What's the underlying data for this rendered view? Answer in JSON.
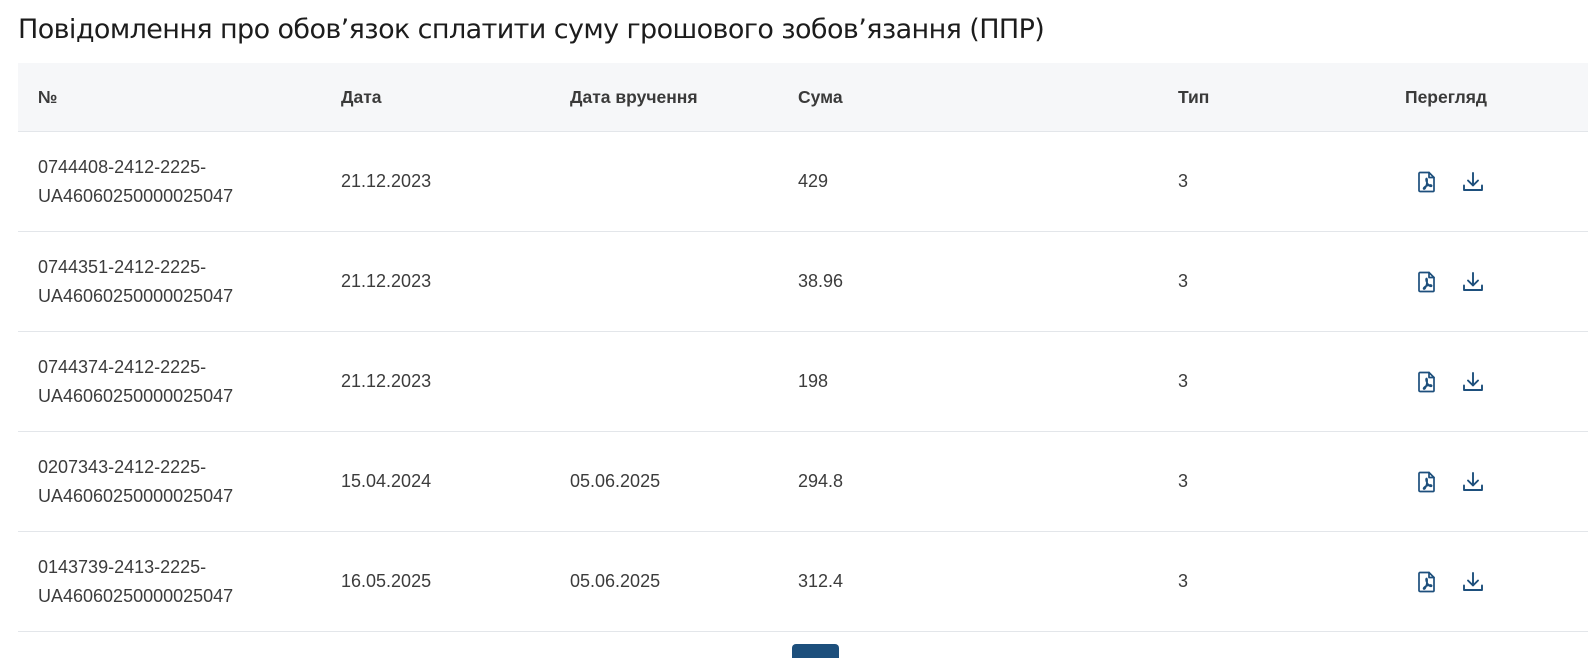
{
  "title": "Повідомлення про обов’язок сплатити суму грошового зобов’язання (ППР)",
  "columns": {
    "number": "№",
    "date": "Дата",
    "delivery_date": "Дата вручення",
    "sum": "Сума",
    "type": "Тип",
    "view": "Перегляд"
  },
  "rows": [
    {
      "number_line1": "0744408-2412-2225-",
      "number_line2": "UA46060250000025047",
      "date": "21.12.2023",
      "delivery_date": "",
      "sum": "429",
      "type": "3"
    },
    {
      "number_line1": "0744351-2412-2225-",
      "number_line2": "UA46060250000025047",
      "date": "21.12.2023",
      "delivery_date": "",
      "sum": "38.96",
      "type": "3"
    },
    {
      "number_line1": "0744374-2412-2225-",
      "number_line2": "UA46060250000025047",
      "date": "21.12.2023",
      "delivery_date": "",
      "sum": "198",
      "type": "3"
    },
    {
      "number_line1": "0207343-2412-2225-",
      "number_line2": "UA46060250000025047",
      "date": "15.04.2024",
      "delivery_date": "05.06.2025",
      "sum": "294.8",
      "type": "3"
    },
    {
      "number_line1": "0143739-2413-2225-",
      "number_line2": "UA46060250000025047",
      "date": "16.05.2025",
      "delivery_date": "05.06.2025",
      "sum": "312.4",
      "type": "3"
    }
  ],
  "icons": {
    "view": "pdf-file-icon",
    "download": "download-icon"
  },
  "colors": {
    "accent": "#1d4f7c",
    "header_bg": "#f6f7f9",
    "border": "#e3e6ea"
  }
}
